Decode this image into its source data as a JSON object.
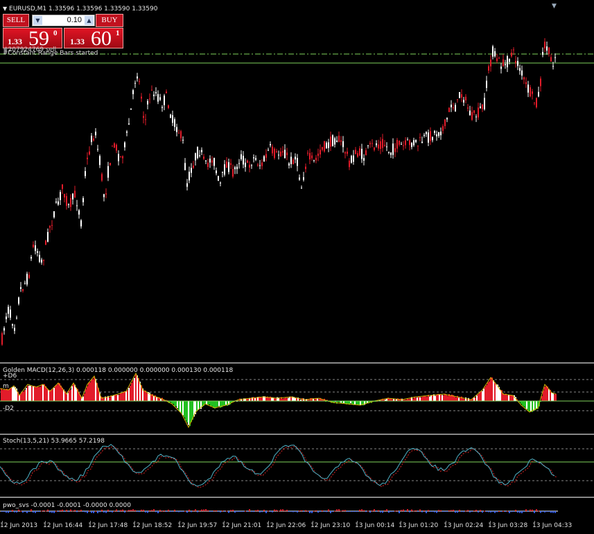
{
  "main": {
    "header": "EURUSD,M1  1.33596 1.33596 1.33590 1.33590",
    "order_label": "#207924769 sell",
    "status_text": "#Constant Range Bars started",
    "trade_panel": {
      "sell_label": "SELL",
      "buy_label": "BUY",
      "lot_value": "0.10",
      "sell_small": "1.33",
      "sell_big": "59",
      "sell_sup": "0",
      "buy_small": "1.33",
      "buy_big": "60",
      "buy_sup": "1"
    }
  },
  "macd": {
    "header": "Golden MACD(12,26,3) 0.000118 0.000000 0.000000 0.000130 0.000118",
    "upper_label": "+D6",
    "mid_label": "m",
    "lower_label": "-D2"
  },
  "stoch": {
    "header": "Stoch(13,5,21) 53.9665 57.2198"
  },
  "pwo": {
    "header": "pwo_svs -0.0001 -0.0001 -0.0000 0.0000"
  },
  "xaxis": {
    "labels": [
      "12 Jun 2013",
      "12 Jun 16:44",
      "12 Jun 17:48",
      "12 Jun 18:52",
      "12 Jun 19:57",
      "12 Jun 21:01",
      "12 Jun 22:06",
      "12 Jun 23:10",
      "13 Jun 00:14",
      "13 Jun 01:20",
      "13 Jun 02:24",
      "13 Jun 03:28",
      "13 Jun 04:33"
    ]
  },
  "colors": {
    "up_candle": "#ffffff",
    "down_candle": "#e21c2a",
    "hist_positive": "#e21c2a",
    "hist_negative": "#22c022",
    "level_line": "#7fd35b",
    "signal_line": "#d6b400"
  }
}
